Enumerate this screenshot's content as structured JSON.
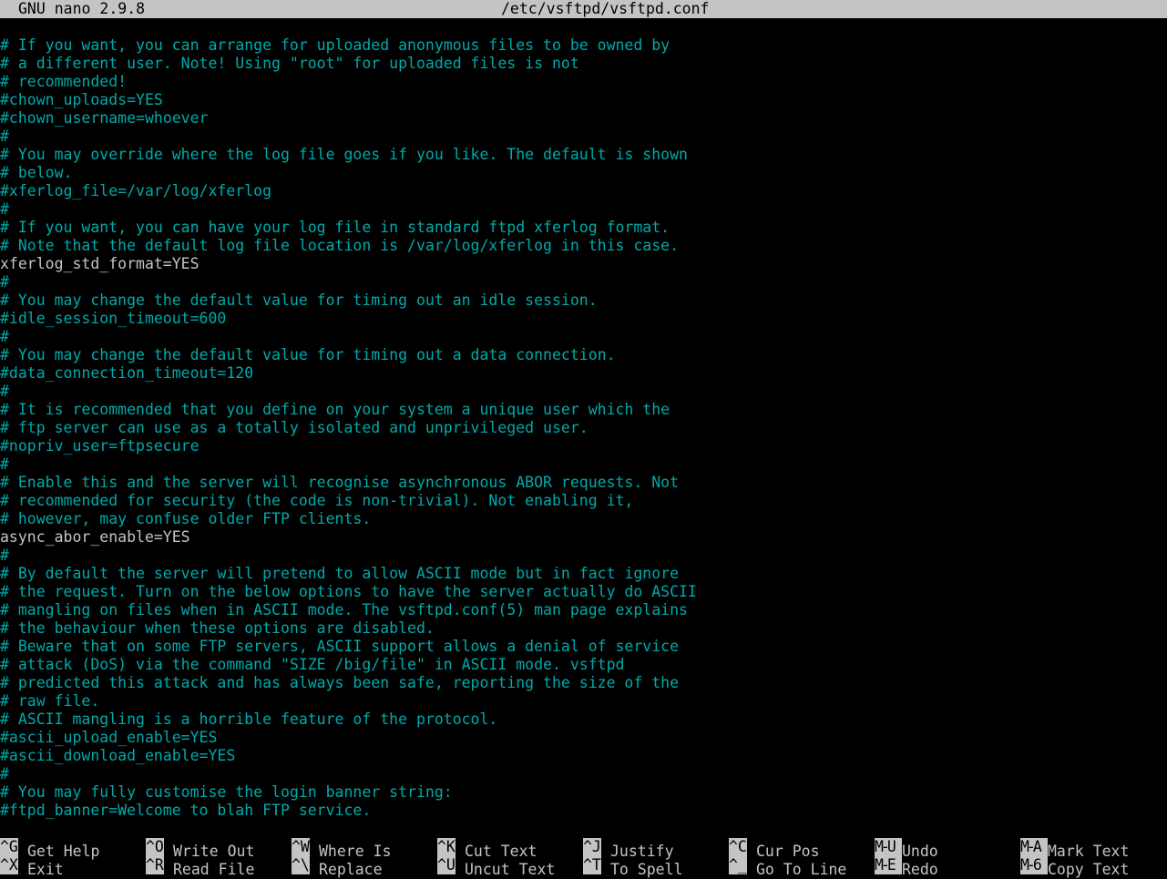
{
  "titlebar": {
    "version": "GNU nano 2.9.8",
    "filename": "/etc/vsftpd/vsftpd.conf"
  },
  "lines": [
    {
      "text": "# If you want, you can arrange for uploaded anonymous files to be owned by",
      "kind": "comment"
    },
    {
      "text": "# a different user. Note! Using \"root\" for uploaded files is not",
      "kind": "comment"
    },
    {
      "text": "# recommended!",
      "kind": "comment"
    },
    {
      "text": "#chown_uploads=YES",
      "kind": "comment"
    },
    {
      "text": "#chown_username=whoever",
      "kind": "comment"
    },
    {
      "text": "#",
      "kind": "comment"
    },
    {
      "text": "# You may override where the log file goes if you like. The default is shown",
      "kind": "comment"
    },
    {
      "text": "# below.",
      "kind": "comment"
    },
    {
      "text": "#xferlog_file=/var/log/xferlog",
      "kind": "comment"
    },
    {
      "text": "#",
      "kind": "comment"
    },
    {
      "text": "# If you want, you can have your log file in standard ftpd xferlog format.",
      "kind": "comment"
    },
    {
      "text": "# Note that the default log file location is /var/log/xferlog in this case.",
      "kind": "comment"
    },
    {
      "text": "xferlog_std_format=YES",
      "kind": "setting"
    },
    {
      "text": "#",
      "kind": "comment"
    },
    {
      "text": "# You may change the default value for timing out an idle session.",
      "kind": "comment"
    },
    {
      "text": "#idle_session_timeout=600",
      "kind": "comment"
    },
    {
      "text": "#",
      "kind": "comment"
    },
    {
      "text": "# You may change the default value for timing out a data connection.",
      "kind": "comment"
    },
    {
      "text": "#data_connection_timeout=120",
      "kind": "comment"
    },
    {
      "text": "#",
      "kind": "comment"
    },
    {
      "text": "# It is recommended that you define on your system a unique user which the",
      "kind": "comment"
    },
    {
      "text": "# ftp server can use as a totally isolated and unprivileged user.",
      "kind": "comment"
    },
    {
      "text": "#nopriv_user=ftpsecure",
      "kind": "comment"
    },
    {
      "text": "#",
      "kind": "comment"
    },
    {
      "text": "# Enable this and the server will recognise asynchronous ABOR requests. Not",
      "kind": "comment"
    },
    {
      "text": "# recommended for security (the code is non-trivial). Not enabling it,",
      "kind": "comment"
    },
    {
      "text": "# however, may confuse older FTP clients.",
      "kind": "comment"
    },
    {
      "text": "async_abor_enable=YES",
      "kind": "setting"
    },
    {
      "text": "#",
      "kind": "comment"
    },
    {
      "text": "# By default the server will pretend to allow ASCII mode but in fact ignore",
      "kind": "comment"
    },
    {
      "text": "# the request. Turn on the below options to have the server actually do ASCII",
      "kind": "comment"
    },
    {
      "text": "# mangling on files when in ASCII mode. The vsftpd.conf(5) man page explains",
      "kind": "comment"
    },
    {
      "text": "# the behaviour when these options are disabled.",
      "kind": "comment"
    },
    {
      "text": "# Beware that on some FTP servers, ASCII support allows a denial of service",
      "kind": "comment"
    },
    {
      "text": "# attack (DoS) via the command \"SIZE /big/file\" in ASCII mode. vsftpd",
      "kind": "comment"
    },
    {
      "text": "# predicted this attack and has always been safe, reporting the size of the",
      "kind": "comment"
    },
    {
      "text": "# raw file.",
      "kind": "comment"
    },
    {
      "text": "# ASCII mangling is a horrible feature of the protocol.",
      "kind": "comment"
    },
    {
      "text": "#ascii_upload_enable=YES",
      "kind": "comment"
    },
    {
      "text": "#ascii_download_enable=YES",
      "kind": "comment"
    },
    {
      "text": "#",
      "kind": "comment"
    },
    {
      "text": "# You may fully customise the login banner string:",
      "kind": "comment"
    },
    {
      "text": "#ftpd_banner=Welcome to blah FTP service.",
      "kind": "comment"
    }
  ],
  "shortcuts": [
    {
      "key": "^G",
      "label": "Get Help",
      "name": "get-help"
    },
    {
      "key": "^X",
      "label": "Exit",
      "name": "exit"
    },
    {
      "key": "^O",
      "label": "Write Out",
      "name": "write-out"
    },
    {
      "key": "^R",
      "label": "Read File",
      "name": "read-file"
    },
    {
      "key": "^W",
      "label": "Where Is",
      "name": "where-is"
    },
    {
      "key": "^\\",
      "label": "Replace",
      "name": "replace"
    },
    {
      "key": "^K",
      "label": "Cut Text",
      "name": "cut-text"
    },
    {
      "key": "^U",
      "label": "Uncut Text",
      "name": "uncut-text"
    },
    {
      "key": "^J",
      "label": "Justify",
      "name": "justify"
    },
    {
      "key": "^T",
      "label": "To Spell",
      "name": "to-spell"
    },
    {
      "key": "^C",
      "label": "Cur Pos",
      "name": "cur-pos"
    },
    {
      "key": "^_",
      "label": "Go To Line",
      "name": "go-to-line"
    },
    {
      "key": "M-U",
      "label": "Undo",
      "name": "undo"
    },
    {
      "key": "M-E",
      "label": "Redo",
      "name": "redo"
    },
    {
      "key": "M-A",
      "label": "Mark Text",
      "name": "mark-text"
    },
    {
      "key": "M-6",
      "label": "Copy Text",
      "name": "copy-text"
    }
  ],
  "colors": {
    "comment": "#00aaaa",
    "text": "#c4c4c4",
    "background": "#000000",
    "bar": "#c4c4c4"
  }
}
